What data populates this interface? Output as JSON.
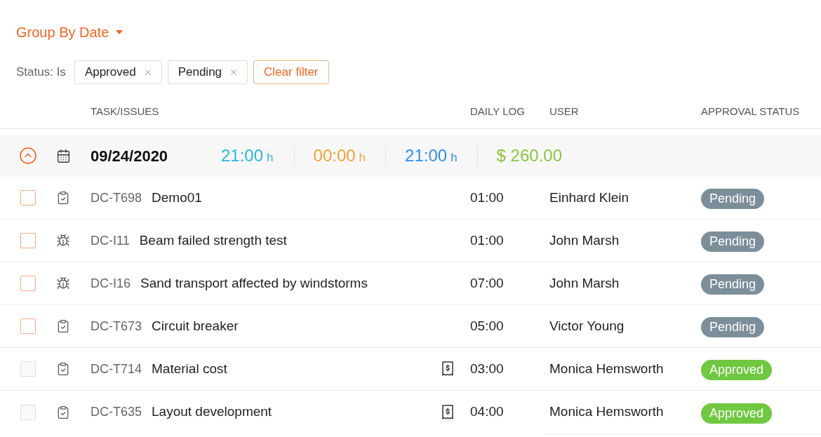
{
  "group_by": {
    "label": "Group By Date"
  },
  "filter": {
    "label": "Status: Is",
    "chips": [
      "Approved",
      "Pending"
    ],
    "clear_button": "Clear filter"
  },
  "table": {
    "columns": [
      "TASK/ISSUES",
      "DAILY LOG",
      "USER",
      "APPROVAL STATUS"
    ],
    "groups": [
      {
        "date": "09/24/2020",
        "expanded": true,
        "totals": [
          {
            "value": "21:00",
            "unit": "h",
            "color": "#2ab7e2"
          },
          {
            "value": "00:00",
            "unit": "h",
            "color": "#f5a335"
          },
          {
            "value": "21:00",
            "unit": "h",
            "color": "#2f8ff0"
          },
          {
            "value": "$ 260.00",
            "color": "#8dc53e"
          }
        ],
        "rows": [
          {
            "kind": "task",
            "id": "DC-T698",
            "title": "Demo01",
            "receipt": false,
            "daily_log": "01:00",
            "user": "Einhard Klein",
            "status": {
              "kind": "pending",
              "label": "Pending"
            },
            "checked": false,
            "disabled": false
          },
          {
            "kind": "issue",
            "id": "DC-I11",
            "title": "Beam failed strength test",
            "receipt": false,
            "daily_log": "01:00",
            "user": "John Marsh",
            "status": {
              "kind": "pending",
              "label": "Pending"
            },
            "checked": false,
            "disabled": false
          },
          {
            "kind": "issue",
            "id": "DC-I16",
            "title": "Sand transport affected by windstorms",
            "receipt": false,
            "daily_log": "07:00",
            "user": "John Marsh",
            "status": {
              "kind": "pending",
              "label": "Pending"
            },
            "checked": false,
            "disabled": false
          },
          {
            "kind": "task",
            "id": "DC-T673",
            "title": "Circuit breaker",
            "receipt": false,
            "daily_log": "05:00",
            "user": "Victor Young",
            "status": {
              "kind": "pending",
              "label": "Pending"
            },
            "checked": false,
            "disabled": false
          },
          {
            "kind": "task",
            "id": "DC-T714",
            "title": "Material cost",
            "receipt": true,
            "daily_log": "03:00",
            "user": "Monica Hemsworth",
            "status": {
              "kind": "approved",
              "label": "Approved"
            },
            "checked": false,
            "disabled": true
          },
          {
            "kind": "task",
            "id": "DC-T635",
            "title": "Layout development",
            "receipt": true,
            "daily_log": "04:00",
            "user": "Monica Hemsworth",
            "status": {
              "kind": "approved",
              "label": "Approved"
            },
            "checked": false,
            "disabled": true
          }
        ]
      }
    ]
  }
}
